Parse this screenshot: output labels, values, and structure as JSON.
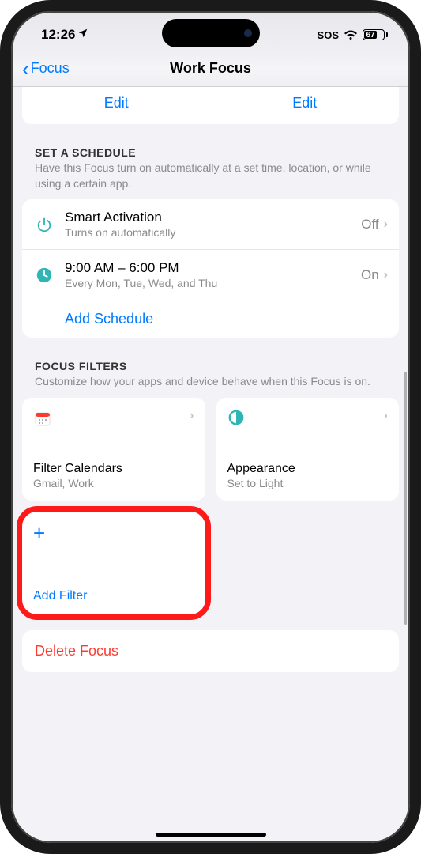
{
  "status": {
    "time": "12:26",
    "sos": "SOS",
    "battery_pct": "67"
  },
  "nav": {
    "back": "Focus",
    "title": "Work Focus"
  },
  "edit_row": {
    "left": "Edit",
    "right": "Edit"
  },
  "schedule": {
    "title": "SET A SCHEDULE",
    "desc": "Have this Focus turn on automatically at a set time, location, or while using a certain app.",
    "smart": {
      "title": "Smart Activation",
      "sub": "Turns on automatically",
      "value": "Off"
    },
    "time": {
      "title": "9:00 AM – 6:00 PM",
      "sub": "Every Mon, Tue, Wed, and Thu",
      "value": "On"
    },
    "add": "Add Schedule"
  },
  "filters": {
    "title": "FOCUS FILTERS",
    "desc": "Customize how your apps and device behave when this Focus is on.",
    "calendar": {
      "title": "Filter Calendars",
      "sub": "Gmail, Work"
    },
    "appearance": {
      "title": "Appearance",
      "sub": "Set to Light"
    },
    "add": "Add Filter"
  },
  "delete": {
    "label": "Delete Focus"
  }
}
